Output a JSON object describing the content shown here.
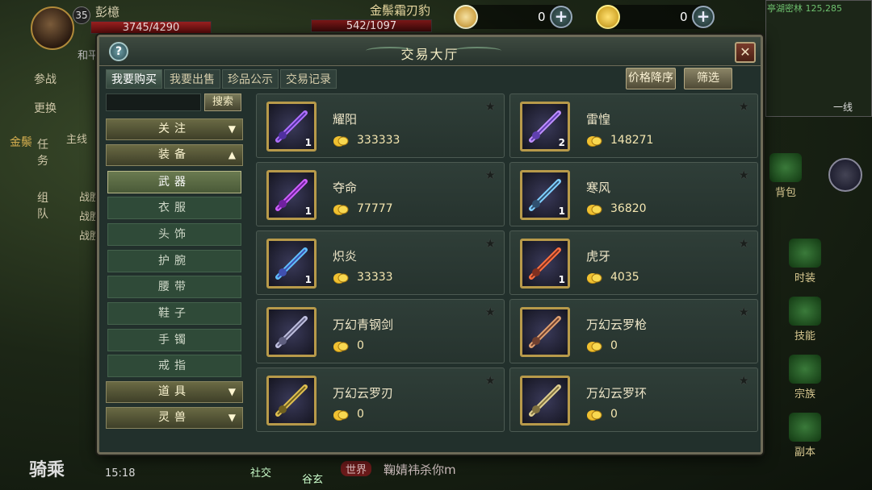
{
  "hud": {
    "level": "35",
    "player_name": "彭檍",
    "hp": "3745/4290",
    "sub_name": "和平",
    "target_name": "金鬃霜刃豹",
    "target_hp": "542/1097",
    "currency1": "0",
    "currency2": "0",
    "map_name": "亭湖密林 125,285",
    "line": "一线",
    "left_tabs": [
      "参战",
      "更换",
      "任务",
      "组队"
    ],
    "left_task": "主线",
    "chat_lines": [
      "战胜",
      "战胜",
      "战胜"
    ],
    "side_buttons": [
      "背包",
      "时装",
      "技能",
      "宗族",
      "副本"
    ],
    "ride": "骑乘",
    "time": "15:18",
    "bottom_buttons": [
      "社交",
      "谷玄"
    ],
    "world_tag": "世界",
    "world_text": "鞠婧祎杀你m",
    "left_gold": "金鬃"
  },
  "dialog": {
    "title": "交易大厅",
    "tabs": [
      "我要购买",
      "我要出售",
      "珍品公示",
      "交易记录"
    ],
    "sort_label": "价格降序",
    "filter_label": "筛选",
    "search_placeholder": "",
    "search_label": "搜索",
    "categories": {
      "follow": "关注",
      "equip": "装备",
      "props": "道具",
      "pet": "灵兽"
    },
    "sub_categories": [
      "武器",
      "衣服",
      "头饰",
      "护腕",
      "腰带",
      "鞋子",
      "手镯",
      "戒指"
    ]
  },
  "items": [
    {
      "name": "耀阳",
      "price": "333333",
      "qty": "1"
    },
    {
      "name": "雷惶",
      "price": "148271",
      "qty": "2"
    },
    {
      "name": "夺命",
      "price": "77777",
      "qty": "1"
    },
    {
      "name": "寒风",
      "price": "36820",
      "qty": "1"
    },
    {
      "name": "炽炎",
      "price": "33333",
      "qty": "1"
    },
    {
      "name": "虎牙",
      "price": "4035",
      "qty": "1"
    },
    {
      "name": "万幻青钢剑",
      "price": "0",
      "qty": ""
    },
    {
      "name": "万幻云罗枪",
      "price": "0",
      "qty": ""
    },
    {
      "name": "万幻云罗刃",
      "price": "0",
      "qty": ""
    },
    {
      "name": "万幻云罗环",
      "price": "0",
      "qty": ""
    }
  ],
  "colors": {
    "gold": "#d8b030",
    "panel": "#22302c",
    "accent_border": "#b89a4a"
  }
}
